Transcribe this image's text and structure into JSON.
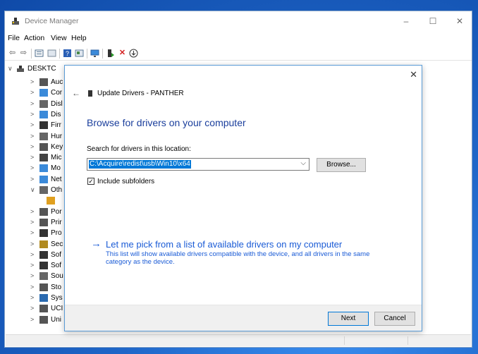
{
  "window": {
    "title": "Device Manager",
    "controls": {
      "minimize": "–",
      "maximize": "☐",
      "close": "✕"
    }
  },
  "menu": [
    "File",
    "Action",
    "View",
    "Help"
  ],
  "toolbar": {
    "icons": [
      "back-arrow",
      "forward-arrow",
      "properties",
      "show-hidden",
      "help",
      "update-driver",
      "monitor",
      "enable-device",
      "uninstall",
      "scan-hardware"
    ]
  },
  "tree": {
    "root": "DESKTC",
    "rows": [
      {
        "chev": ">",
        "label": "Auc"
      },
      {
        "chev": ">",
        "label": "Cor"
      },
      {
        "chev": ">",
        "label": "Disl"
      },
      {
        "chev": ">",
        "label": "Dis"
      },
      {
        "chev": ">",
        "label": "Firr"
      },
      {
        "chev": ">",
        "label": "Hur"
      },
      {
        "chev": ">",
        "label": "Key"
      },
      {
        "chev": ">",
        "label": "Mic"
      },
      {
        "chev": ">",
        "label": "Mo"
      },
      {
        "chev": ">",
        "label": "Net"
      },
      {
        "chev": "∨",
        "label": "Oth"
      },
      {
        "chev": "",
        "label": ""
      },
      {
        "chev": ">",
        "label": "Por"
      },
      {
        "chev": ">",
        "label": "Prir"
      },
      {
        "chev": ">",
        "label": "Pro"
      },
      {
        "chev": ">",
        "label": "Sec"
      },
      {
        "chev": ">",
        "label": "Sof"
      },
      {
        "chev": ">",
        "label": "Sof"
      },
      {
        "chev": ">",
        "label": "Sou"
      },
      {
        "chev": ">",
        "label": "Sto"
      },
      {
        "chev": ">",
        "label": "Sys"
      },
      {
        "chev": ">",
        "label": "UCI"
      },
      {
        "chev": ">",
        "label": "Uni"
      }
    ]
  },
  "wizard": {
    "close": "✕",
    "back": "←",
    "header": "Update Drivers - PANTHER",
    "title": "Browse for drivers on your computer",
    "search_label": "Search for drivers in this location:",
    "path_value": "C:\\Acquire\\redist\\usb\\Win10\\x64",
    "browse_label": "Browse...",
    "include_subfolders": "Include subfolders",
    "include_checked": "✓",
    "pick_arrow": "→",
    "pick_link": "Let me pick from a list of available drivers on my computer",
    "pick_desc": "This list will show available drivers compatible with the device, and all drivers in the same category as the device.",
    "next_label": "Next",
    "cancel_label": "Cancel"
  }
}
